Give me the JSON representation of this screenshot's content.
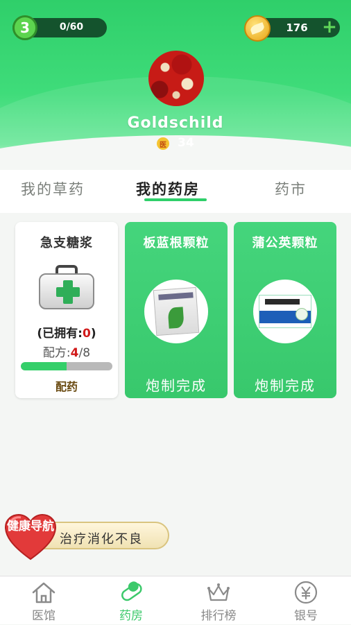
{
  "header": {
    "level": "3",
    "level_progress": "0/60",
    "coins": "176",
    "username": "Goldschild",
    "doctor_badge": "医",
    "doctor_value": "34"
  },
  "tabs": [
    {
      "label": "我的草药",
      "active": false
    },
    {
      "label": "我的药房",
      "active": true
    },
    {
      "label": "药市",
      "active": false
    }
  ],
  "cards": [
    {
      "title": "急支糖浆",
      "owned_prefix": "(已拥有:",
      "owned_count": "0",
      "owned_suffix": ")",
      "recipe_prefix": "配方:",
      "recipe_have": "4",
      "recipe_sep": "/",
      "recipe_total": "8",
      "progress_fraction": 0.5,
      "action": "配药"
    },
    {
      "title": "板蓝根颗粒",
      "status": "炮制完成"
    },
    {
      "title": "蒲公英颗粒",
      "status": "炮制完成"
    }
  ],
  "health_nav": {
    "heart_label": "健康导航",
    "text": "治疗消化不良"
  },
  "bottom_nav": [
    {
      "label": "医馆",
      "icon": "house-icon",
      "active": false
    },
    {
      "label": "药房",
      "icon": "pill-icon",
      "active": true
    },
    {
      "label": "排行榜",
      "icon": "crown-icon",
      "active": false
    },
    {
      "label": "银号",
      "icon": "yuan-coin-icon",
      "active": false
    }
  ],
  "colors": {
    "accent": "#2fcf6a",
    "highlight_red": "#d11a1a"
  }
}
